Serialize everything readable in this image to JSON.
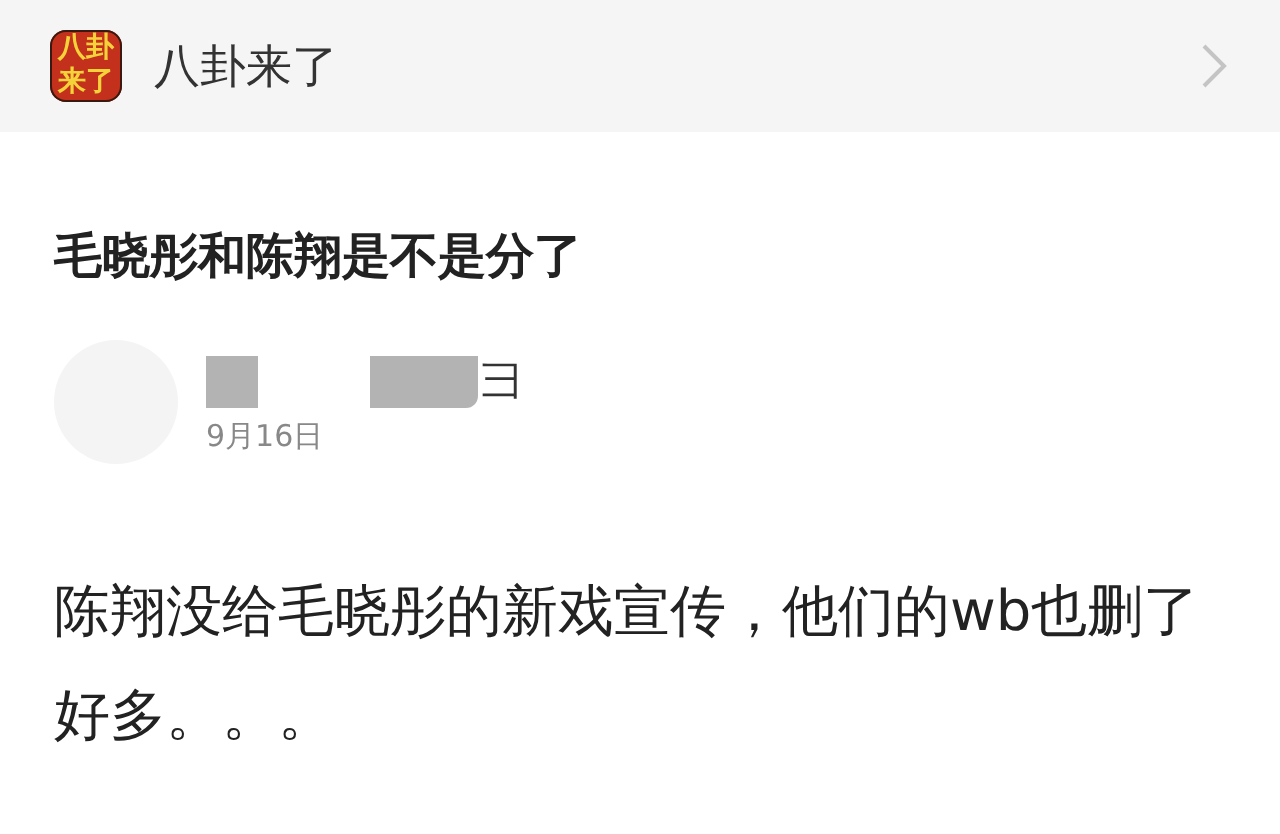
{
  "header": {
    "logo": {
      "text": "八卦来了"
    },
    "title": "八卦来了"
  },
  "question": {
    "title": "毛晓彤和陈翔是不是分了"
  },
  "answer": {
    "author": {
      "redacted": true,
      "name_visible": "彐"
    },
    "date": "9月16日",
    "body": "陈翔没给毛晓彤的新戏宣传，他们的wb也删了好多。。。"
  }
}
